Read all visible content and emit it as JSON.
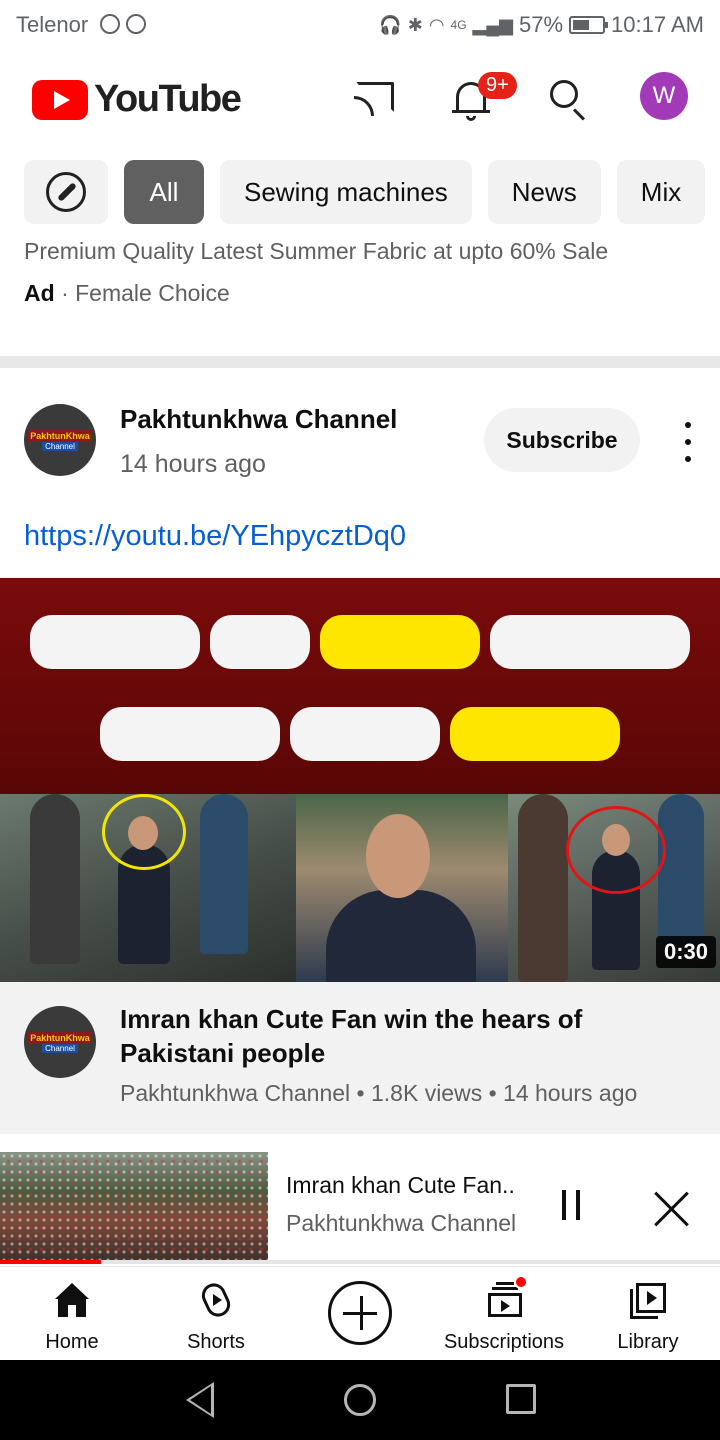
{
  "status_bar": {
    "carrier": "Telenor",
    "network": "4G",
    "battery": "57%",
    "battery_level": 0.57,
    "time": "10:17 AM"
  },
  "header": {
    "logo_text": "YouTube",
    "notification_badge": "9+",
    "avatar_initial": "W",
    "avatar_color": "#a23ab8"
  },
  "chips": [
    "All",
    "Sewing machines",
    "News",
    "Mix"
  ],
  "ad": {
    "text": "Premium Quality Latest Summer Fabric at upto 60% Sale",
    "label": "Ad",
    "advertiser": "Female Choice"
  },
  "post": {
    "channel": "Pakhtunkhwa Channel",
    "time": "14 hours ago",
    "subscribe_label": "Subscribe",
    "link": "https://youtu.be/YEhpycztDq0"
  },
  "video": {
    "duration": "0:30",
    "title": "Imran khan Cute Fan win the hears of Pakistani people",
    "meta": "Pakhtunkhwa Channel • 1.8K views • 14 hours ago"
  },
  "channel_logo": {
    "line1": "PakhtunKhwa",
    "line2": "Channel"
  },
  "mini_player": {
    "title": "Imran khan Cute Fan..",
    "channel": "Pakhtunkhwa Channel",
    "progress": 0.14
  },
  "bottom_nav": {
    "home": "Home",
    "shorts": "Shorts",
    "subscriptions": "Subscriptions",
    "library": "Library"
  },
  "colors": {
    "brand_red": "#ff0000",
    "link_blue": "#065fd4",
    "badge_red": "#e62117"
  }
}
